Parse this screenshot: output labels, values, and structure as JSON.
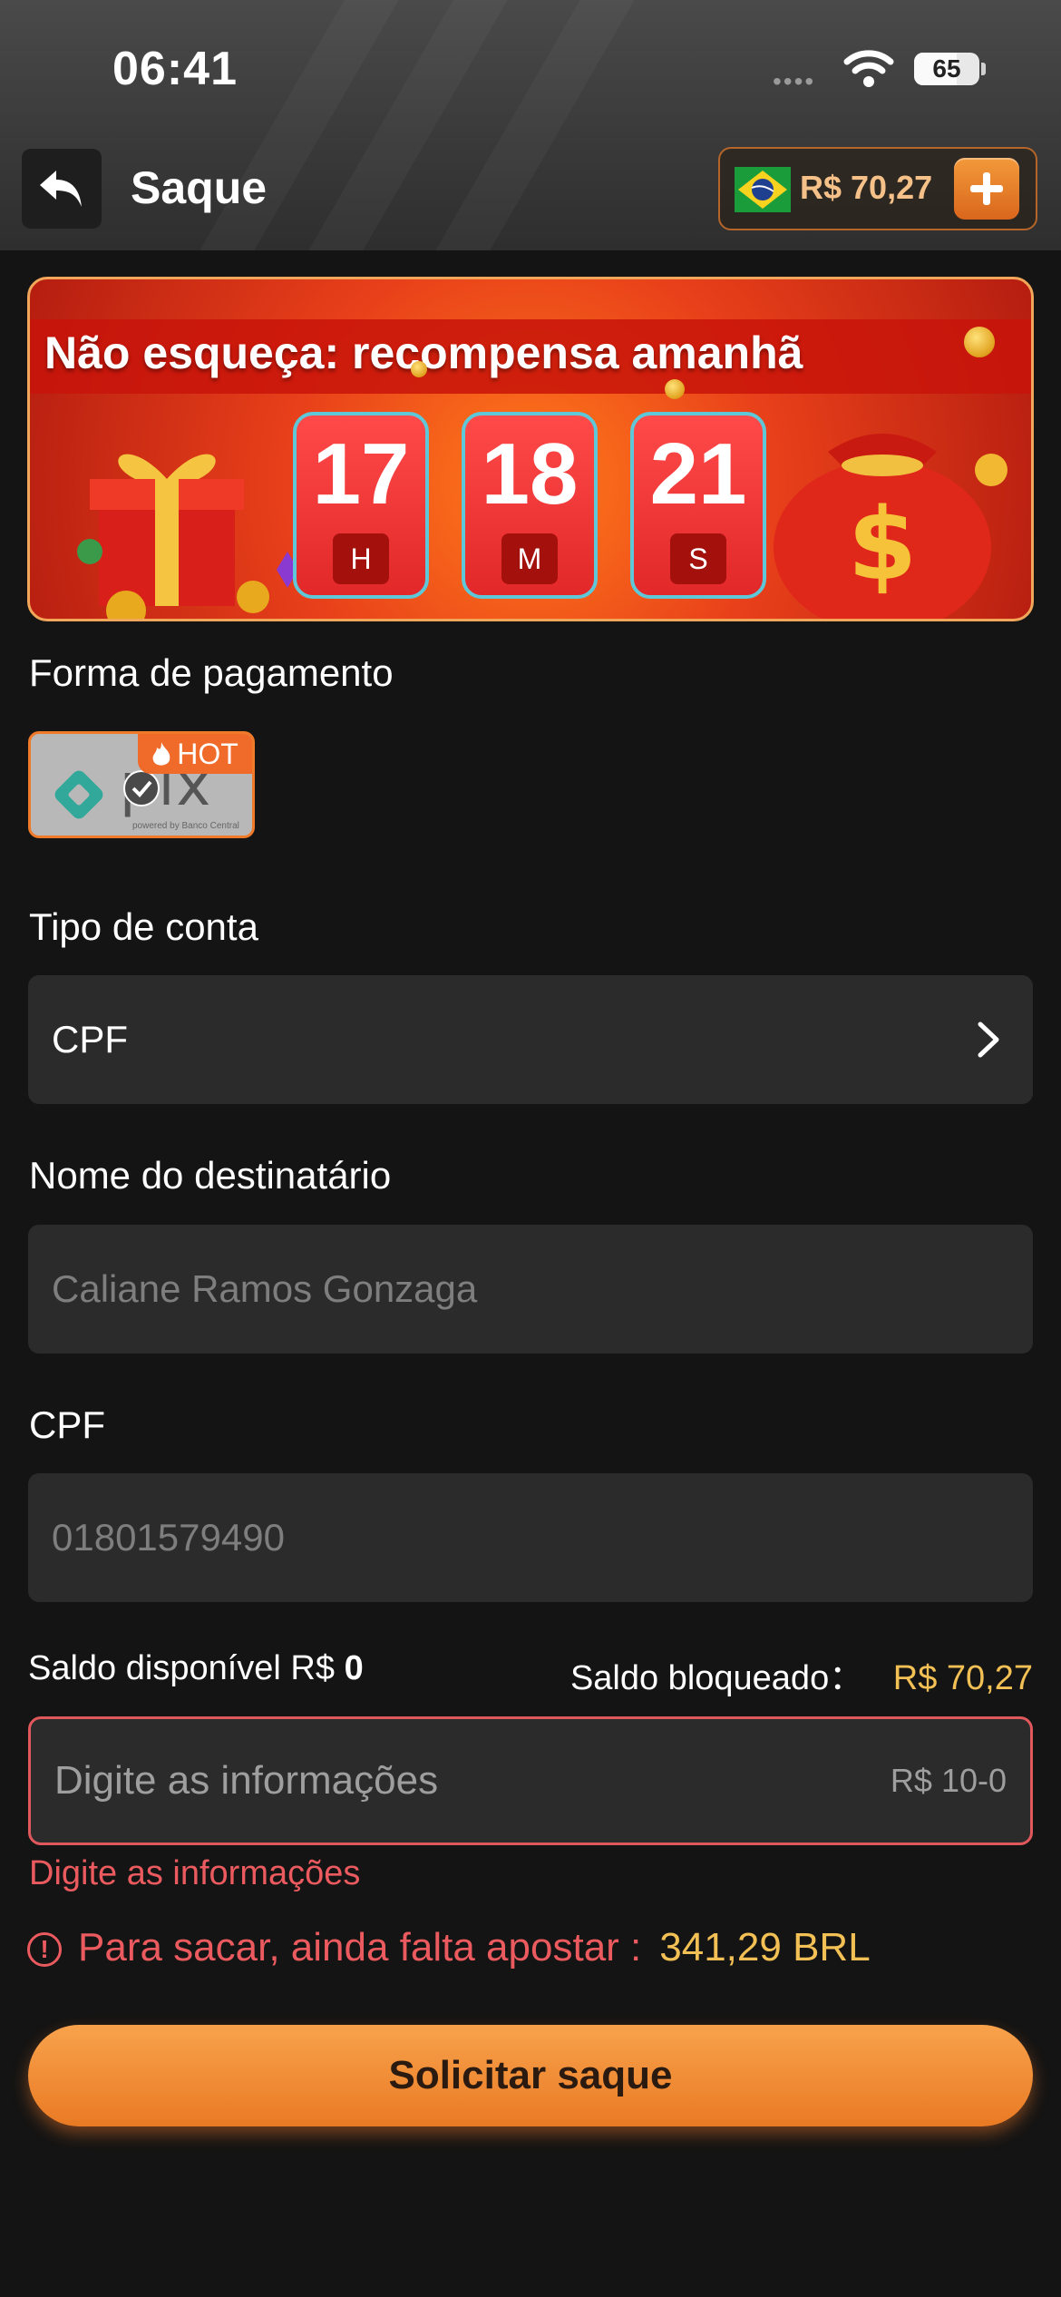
{
  "status_bar": {
    "time": "06:41",
    "battery": "65",
    "battery_level": 0.65
  },
  "header": {
    "title": "Saque",
    "balance": "R$ 70,27"
  },
  "banner": {
    "title": "Não esqueça: recompensa amanhã",
    "timer": [
      {
        "value": "17",
        "unit": "H"
      },
      {
        "value": "18",
        "unit": "M"
      },
      {
        "value": "21",
        "unit": "S"
      }
    ]
  },
  "payment": {
    "label": "Forma de pagamento",
    "method_text": "pix",
    "method_sub": "powered by Banco Central",
    "badge": "HOT"
  },
  "account_type": {
    "label": "Tipo de conta",
    "value": "CPF"
  },
  "recipient": {
    "label": "Nome do destinatário",
    "placeholder": "Caliane Ramos Gonzaga"
  },
  "cpf": {
    "label": "CPF",
    "placeholder": "01801579490"
  },
  "balances": {
    "available_label": "Saldo disponível R$",
    "available_value": "0",
    "blocked_label": "Saldo bloqueado：",
    "blocked_value": "R$ 70,27"
  },
  "amount": {
    "placeholder": "Digite as informações",
    "range": "R$ 10-0",
    "error": "Digite as informações"
  },
  "warning": {
    "text": "Para sacar, ainda falta apostar :",
    "amount": "341,29 BRL"
  },
  "submit": {
    "label": "Solicitar saque"
  },
  "colors": {
    "accent": "#ea7a24",
    "error": "#ea5a5e",
    "gold": "#f2c054"
  }
}
